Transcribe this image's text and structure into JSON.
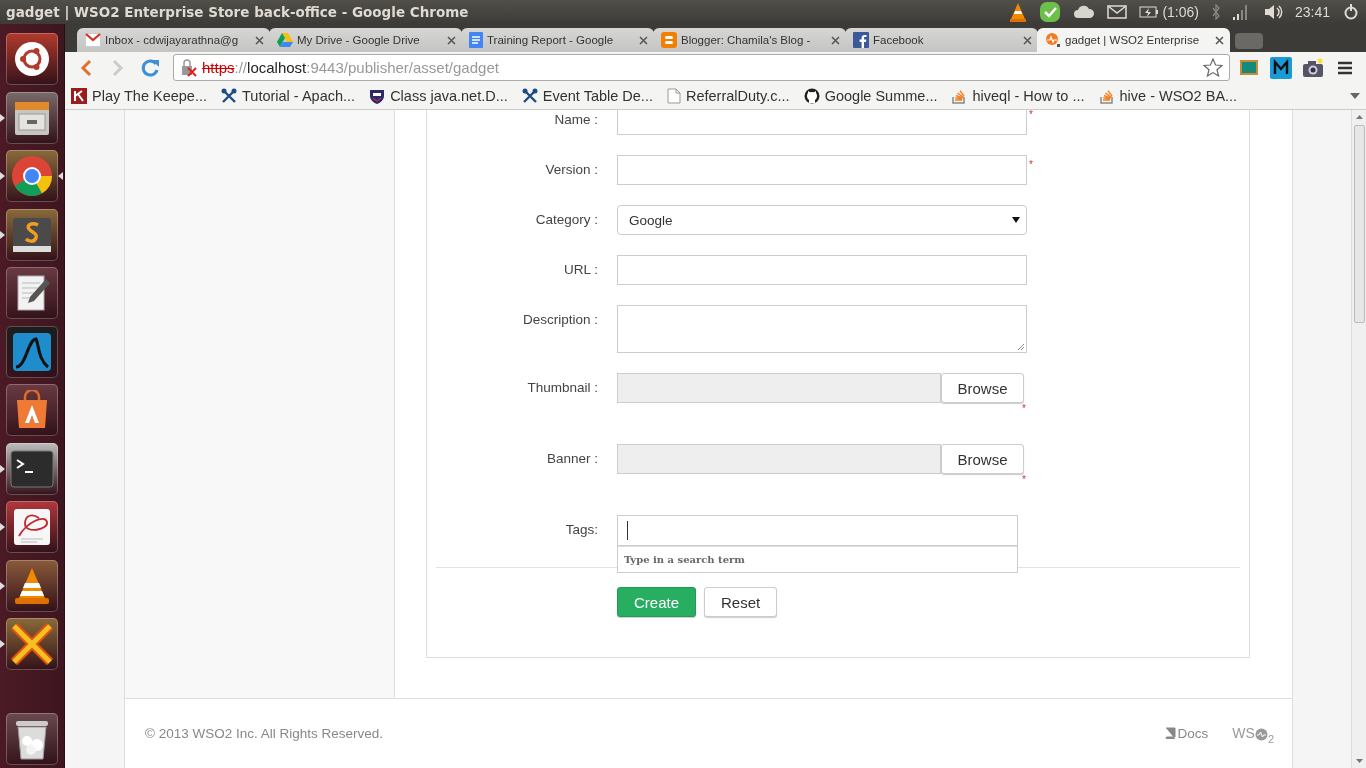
{
  "top_panel": {
    "title": "gadget | WSO2 Enterprise Store back-office - Google Chrome",
    "battery_time": "(1:06)",
    "clock": "23:41"
  },
  "launcher": {
    "items": [
      {
        "kind": "ubuntu",
        "running": false,
        "focused": false
      },
      {
        "kind": "files",
        "running": true,
        "focused": false
      },
      {
        "kind": "chrome",
        "running": true,
        "focused": true
      },
      {
        "kind": "sublime",
        "running": true,
        "focused": false
      },
      {
        "kind": "editor",
        "running": false,
        "focused": false
      },
      {
        "kind": "wireshark",
        "running": false,
        "focused": false
      },
      {
        "kind": "software",
        "running": false,
        "focused": false
      },
      {
        "kind": "terminal",
        "running": true,
        "focused": false
      },
      {
        "kind": "pdf",
        "running": true,
        "focused": false
      },
      {
        "kind": "vlc",
        "running": true,
        "focused": false
      },
      {
        "kind": "xchat",
        "running": true,
        "focused": false
      },
      {
        "kind": "trash",
        "running": false,
        "focused": false
      }
    ]
  },
  "browser": {
    "tabs": [
      {
        "kind": "gmail",
        "label": "Inbox - cdwijayarathna@g",
        "selected": false
      },
      {
        "kind": "drive",
        "label": "My Drive - Google Drive",
        "selected": false
      },
      {
        "kind": "docs",
        "label": "Training Report - Google",
        "selected": false
      },
      {
        "kind": "blogger",
        "label": "Blogger: Chamila's Blog -",
        "selected": false
      },
      {
        "kind": "facebook",
        "label": "Facebook",
        "selected": false
      },
      {
        "kind": "wso2",
        "label": "gadget | WSO2 Enterprise",
        "selected": true
      }
    ],
    "address": {
      "scheme": "https",
      "separator": "://",
      "host": "localhost",
      "path": ":9443/publisher/asset/gadget"
    },
    "bookmarks": [
      {
        "kind": "k",
        "label": "Play The Keepe..."
      },
      {
        "kind": "tool",
        "label": "Tutorial - Apach..."
      },
      {
        "kind": "shield",
        "label": "Class java.net.D..."
      },
      {
        "kind": "tool",
        "label": "Event Table De..."
      },
      {
        "kind": "page",
        "label": "ReferralDuty.c..."
      },
      {
        "kind": "github",
        "label": "Google Summe..."
      },
      {
        "kind": "stack",
        "label": "hiveql - How to ..."
      },
      {
        "kind": "stack",
        "label": "hive - WSO2 BA..."
      }
    ]
  },
  "page": {
    "form": {
      "fields": [
        {
          "kind": "text",
          "label": "Name :",
          "required_mark": "*"
        },
        {
          "kind": "text",
          "label": "Version :",
          "required_mark": "*"
        },
        {
          "kind": "select",
          "label": "Category :",
          "value": "Google"
        },
        {
          "kind": "text",
          "label": "URL :"
        },
        {
          "kind": "textarea",
          "label": "Description :"
        },
        {
          "kind": "file",
          "label": "Thumbnail :",
          "button": "Browse",
          "required_mark": "*"
        },
        {
          "kind": "file",
          "label": "Banner :",
          "button": "Browse",
          "required_mark": "*"
        },
        {
          "kind": "tags",
          "label": "Tags:",
          "hint": "Type in a search term"
        }
      ],
      "buttons": [
        {
          "label": "Create",
          "kind": "primary"
        },
        {
          "label": "Reset",
          "kind": "default"
        }
      ]
    },
    "footer": {
      "copyright": "© 2013 WSO2 Inc. All Rights Reserved.",
      "docs": "Docs",
      "logo_prefix": "WS",
      "logo_suffix": "2"
    }
  }
}
